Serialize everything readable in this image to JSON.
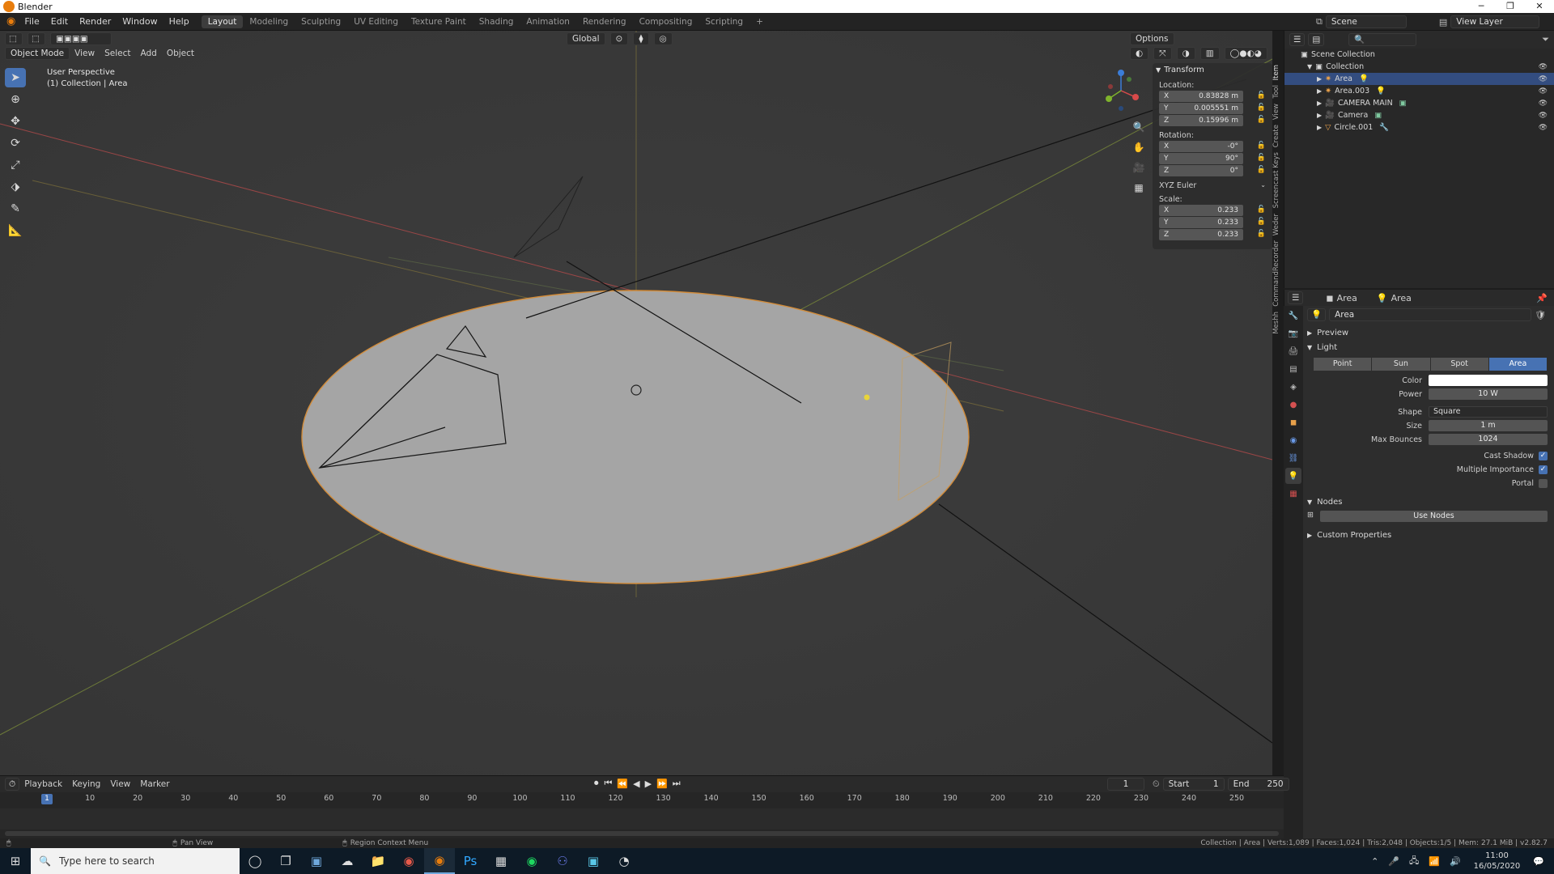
{
  "window": {
    "title": "Blender"
  },
  "menu": [
    "File",
    "Edit",
    "Render",
    "Window",
    "Help"
  ],
  "workspaces": [
    "Layout",
    "Modeling",
    "Sculpting",
    "UV Editing",
    "Texture Paint",
    "Shading",
    "Animation",
    "Rendering",
    "Compositing",
    "Scripting"
  ],
  "workspace_add": "+",
  "scene": {
    "name": "Scene",
    "view_layer": "View Layer"
  },
  "viewport": {
    "mode": "Object Mode",
    "menus": [
      "View",
      "Select",
      "Add",
      "Object"
    ],
    "transform_orientation": "Global",
    "options_label": "Options",
    "overlay_title": "User Perspective",
    "overlay_subtitle": "(1) Collection | Area"
  },
  "npanel": {
    "header": "Transform",
    "location_label": "Location:",
    "location": [
      {
        "axis": "X",
        "value": "0.83828 m"
      },
      {
        "axis": "Y",
        "value": "0.005551 m"
      },
      {
        "axis": "Z",
        "value": "0.15996 m"
      }
    ],
    "rotation_label": "Rotation:",
    "rotation": [
      {
        "axis": "X",
        "value": "-0°"
      },
      {
        "axis": "Y",
        "value": "90°"
      },
      {
        "axis": "Z",
        "value": "0°"
      }
    ],
    "rotation_mode": "XYZ Euler",
    "scale_label": "Scale:",
    "scale": [
      {
        "axis": "X",
        "value": "0.233"
      },
      {
        "axis": "Y",
        "value": "0.233"
      },
      {
        "axis": "Z",
        "value": "0.233"
      }
    ],
    "tabs": [
      "Item",
      "Tool",
      "View",
      "Create",
      "Screencast Keys",
      "Weder",
      "CommandRecorder",
      "Meshh"
    ]
  },
  "outliner": {
    "root": "Scene Collection",
    "collection": "Collection",
    "items": [
      {
        "name": "Area",
        "selected": true
      },
      {
        "name": "Area.003",
        "selected": false
      },
      {
        "name": "CAMERA MAIN",
        "selected": false
      },
      {
        "name": "Camera",
        "selected": false
      },
      {
        "name": "Circle.001",
        "selected": false
      }
    ]
  },
  "properties": {
    "object_name": "Area",
    "data_name": "Area",
    "datablock": "Area",
    "sections": {
      "preview": "Preview",
      "light": "Light",
      "nodes": "Nodes",
      "custom": "Custom Properties"
    },
    "light_types": [
      "Point",
      "Sun",
      "Spot",
      "Area"
    ],
    "active_light_type": "Area",
    "color_label": "Color",
    "color_value": "#ffffff",
    "power_label": "Power",
    "power_value": "10 W",
    "shape_label": "Shape",
    "shape_value": "Square",
    "size_label": "Size",
    "size_value": "1 m",
    "bounces_label": "Max Bounces",
    "bounces_value": "1024",
    "cast_shadow_label": "Cast Shadow",
    "multiple_importance_label": "Multiple Importance",
    "portal_label": "Portal",
    "cast_shadow": true,
    "multiple_importance": true,
    "portal": false,
    "use_nodes": "Use Nodes"
  },
  "timeline": {
    "menus": [
      "Playback",
      "Keying",
      "View",
      "Marker"
    ],
    "current_frame": "1",
    "start_label": "Start",
    "start": "1",
    "end_label": "End",
    "end": "250",
    "ticks": [
      "10",
      "20",
      "30",
      "40",
      "50",
      "60",
      "70",
      "80",
      "90",
      "100",
      "110",
      "120",
      "130",
      "140",
      "150",
      "160",
      "170",
      "180",
      "190",
      "200",
      "210",
      "220",
      "230",
      "240",
      "250"
    ]
  },
  "status": {
    "pan": "Pan View",
    "context": "Region Context Menu",
    "stats": "Collection | Area | Verts:1,089 | Faces:1,024 | Tris:2,048 | Objects:1/5 | Mem: 27.1 MiB | v2.82.7"
  },
  "taskbar": {
    "search_placeholder": "Type here to search",
    "time": "11:00",
    "date": "16/05/2020"
  }
}
